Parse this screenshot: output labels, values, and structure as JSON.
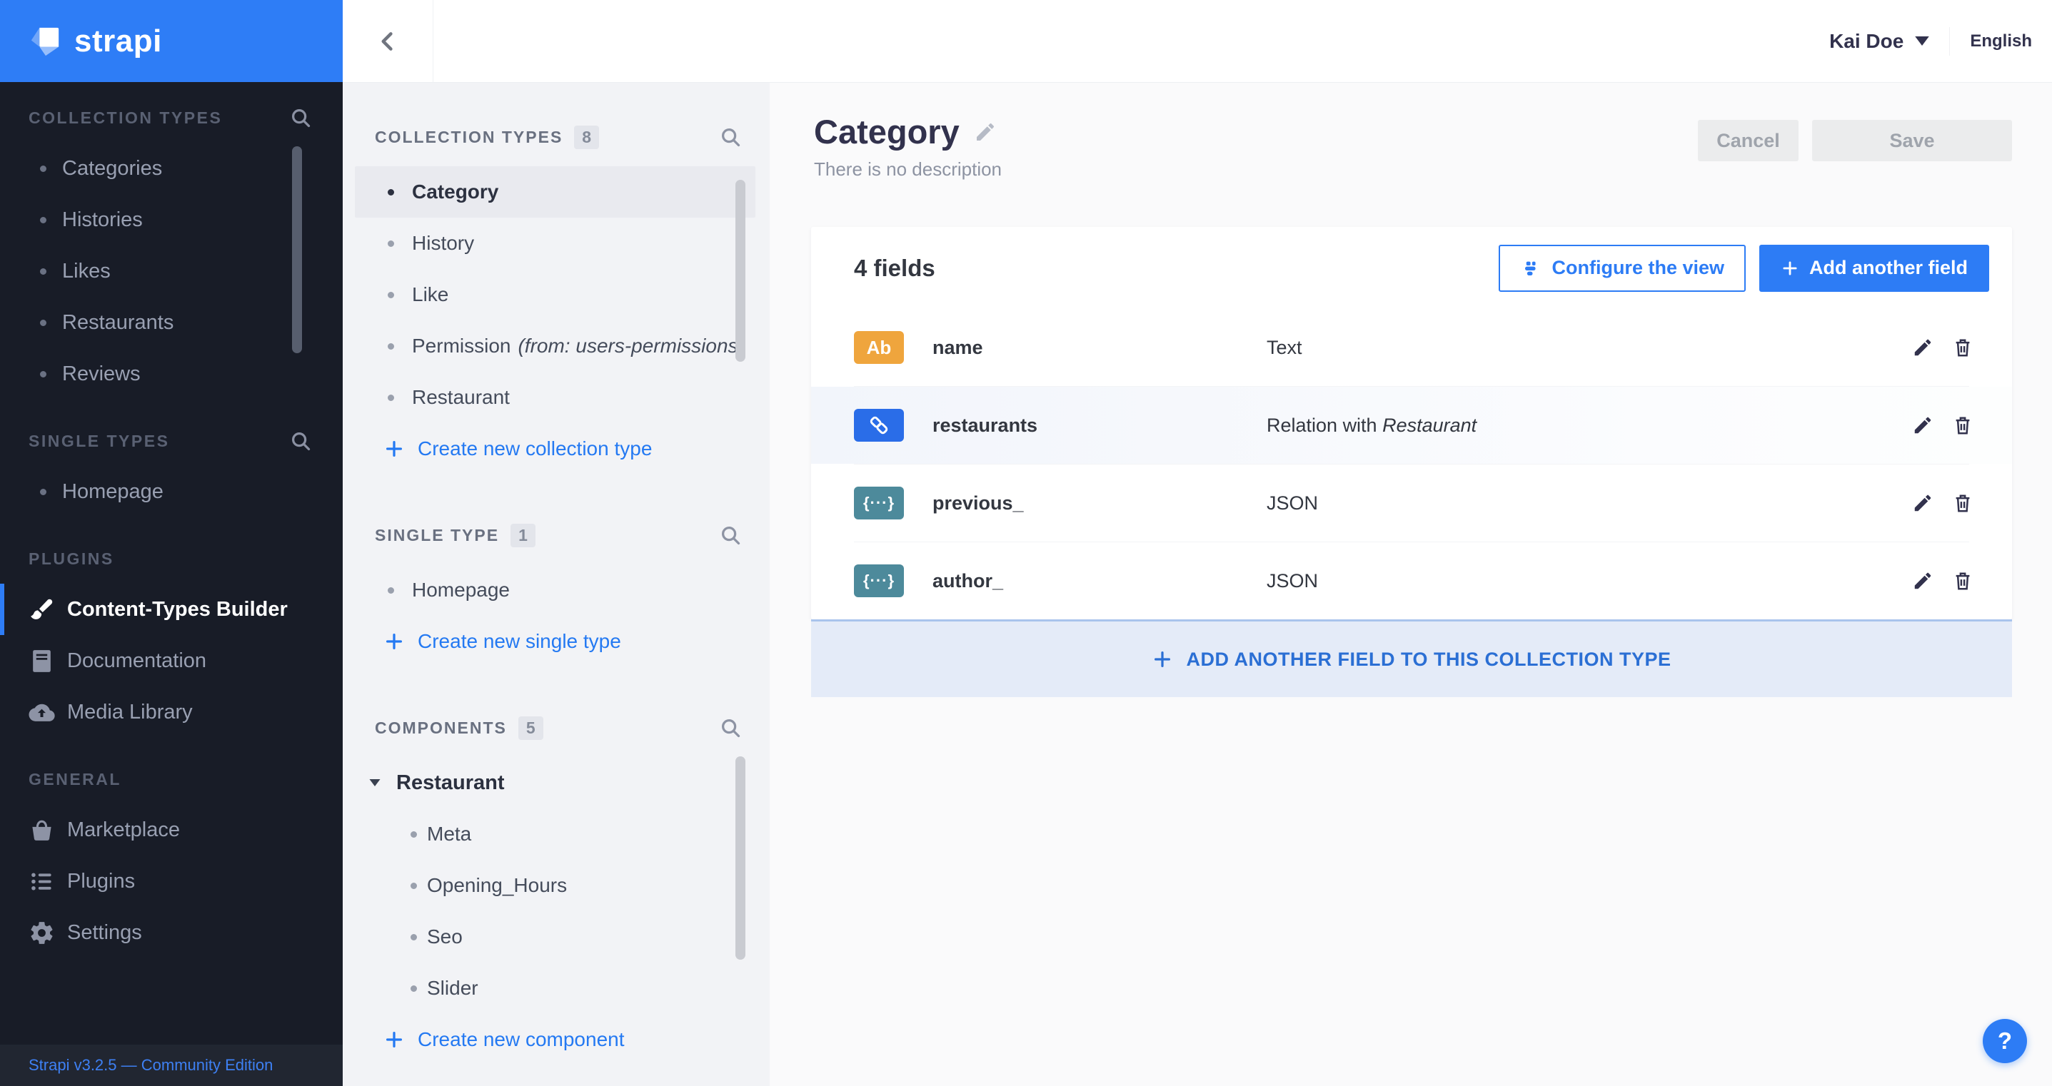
{
  "app": {
    "logo_text": "strapi",
    "version_text": "Strapi v3.2.5 — Community Edition"
  },
  "user_menu": {
    "name": "Kai Doe",
    "locale": "English"
  },
  "left_nav": {
    "sections": [
      {
        "label": "COLLECTION TYPES",
        "items": [
          "Categories",
          "Histories",
          "Likes",
          "Restaurants",
          "Reviews"
        ]
      },
      {
        "label": "SINGLE TYPES",
        "items": [
          "Homepage"
        ]
      },
      {
        "label": "PLUGINS",
        "items": [
          {
            "label": "Content-Types Builder",
            "icon": "paintbrush-icon",
            "active": true
          },
          {
            "label": "Documentation",
            "icon": "book-icon"
          },
          {
            "label": "Media Library",
            "icon": "cloud-upload-icon"
          }
        ]
      },
      {
        "label": "GENERAL",
        "items": [
          {
            "label": "Marketplace",
            "icon": "basket-icon"
          },
          {
            "label": "Plugins",
            "icon": "list-icon"
          },
          {
            "label": "Settings",
            "icon": "gear-icon"
          }
        ]
      }
    ]
  },
  "builder_nav": {
    "collection_types": {
      "label": "COLLECTION TYPES",
      "count": "8",
      "items": [
        {
          "label": "Category",
          "active": true
        },
        {
          "label": "History"
        },
        {
          "label": "Like"
        },
        {
          "label": "Permission",
          "suffix": "(from: users-permissions)"
        },
        {
          "label": "Restaurant"
        }
      ],
      "create_label": "Create new collection type"
    },
    "single_types": {
      "label": "SINGLE TYPE",
      "count": "1",
      "items": [
        {
          "label": "Homepage"
        }
      ],
      "create_label": "Create new single type"
    },
    "components": {
      "label": "COMPONENTS",
      "count": "5",
      "group_label": "Restaurant",
      "items": [
        "Meta",
        "Opening_Hours",
        "Seo",
        "Slider"
      ],
      "create_label": "Create new component"
    }
  },
  "page": {
    "title": "Category",
    "description": "There is no description",
    "cancel_label": "Cancel",
    "save_label": "Save",
    "fields_count_label": "4 fields",
    "configure_view_label": "Configure the view",
    "add_field_label": "Add another field",
    "add_field_banner": "ADD ANOTHER FIELD TO THIS COLLECTION TYPE",
    "help_label": "?"
  },
  "fields": [
    {
      "icon_label": "Ab",
      "icon_kind": "text-field-icon",
      "name": "name",
      "type": "Text"
    },
    {
      "icon_kind": "relation-icon",
      "name": "restaurants",
      "type_prefix": "Relation with ",
      "type_italic": "Restaurant"
    },
    {
      "icon_label": "{···}",
      "icon_kind": "json-icon",
      "name": "previous_",
      "type": "JSON"
    },
    {
      "icon_label": "{···}",
      "icon_kind": "json-icon",
      "name": "author_",
      "type": "JSON"
    }
  ],
  "colors": {
    "brand_blue": "#2e7df6",
    "primary_button": "#2d7cf5",
    "link_blue": "#2479f2",
    "sidebar_bg": "#181c27",
    "panel_bg": "#f2f3f6",
    "field_text_icon": "#efa53d",
    "field_relation_icon": "#2a6de8",
    "field_json_icon": "#4d8a9b",
    "banner_bg": "#e4ebf8",
    "banner_border": "#a9c4ec"
  }
}
